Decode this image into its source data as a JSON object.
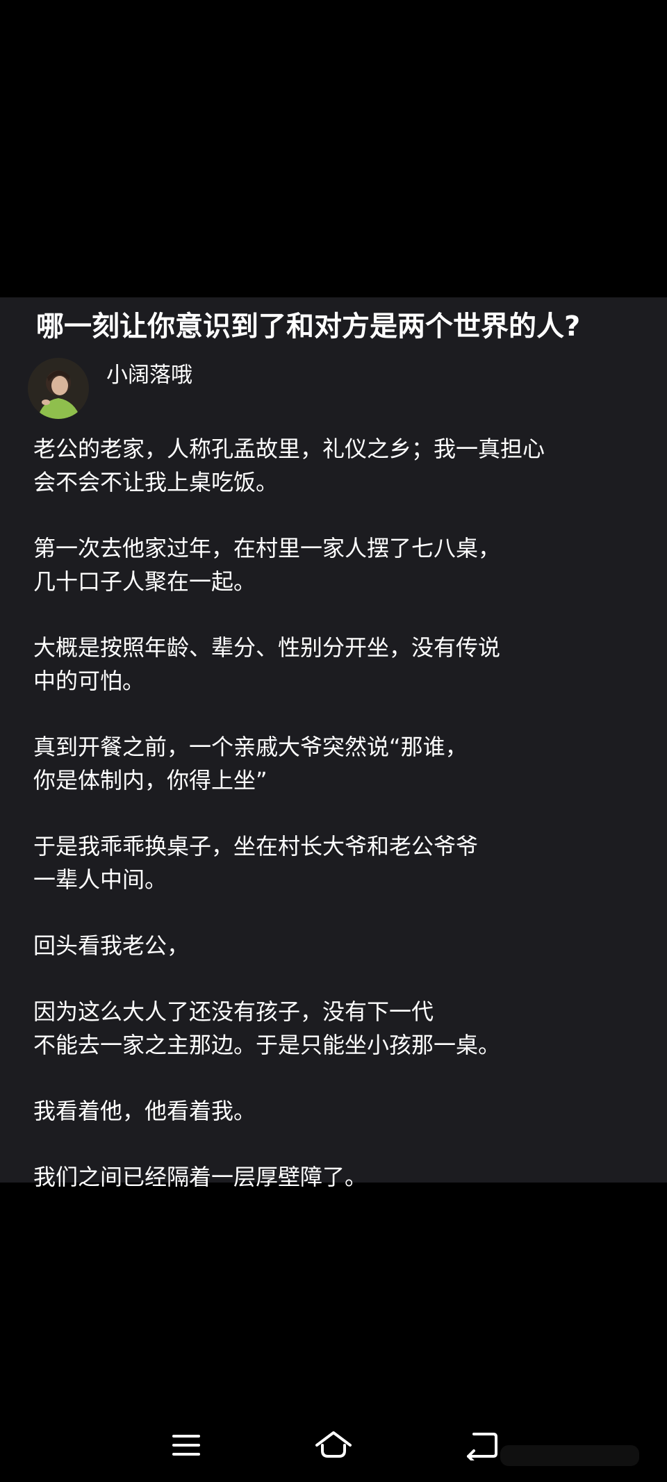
{
  "post": {
    "title": "哪一刻让你意识到了和对方是两个世界的人?",
    "author": {
      "name": "小阔落哦",
      "avatar_icon": "avatar-photo"
    },
    "paragraphs": [
      {
        "lines": [
          "老公的老家，人称孔孟故里，礼仪之乡；我一真担心",
          "会不会不让我上桌吃饭。"
        ]
      },
      {
        "lines": [
          "第一次去他家过年，在村里一家人摆了七八桌，",
          "几十口子人聚在一起。"
        ]
      },
      {
        "lines": [
          "大概是按照年龄、辈分、性别分开坐，没有传说",
          "中的可怕。"
        ]
      },
      {
        "lines": [
          "真到开餐之前，一个亲戚大爷突然说“那谁，",
          "你是体制内，你得上坐”"
        ]
      },
      {
        "lines": [
          "于是我乖乖换桌子，坐在村长大爷和老公爷爷",
          "一辈人中间。"
        ]
      },
      {
        "lines": [
          "回头看我老公，"
        ]
      },
      {
        "lines": [
          "因为这么大人了还没有孩子，没有下一代",
          "不能去一家之主那边。于是只能坐小孩那一桌。"
        ]
      },
      {
        "lines": [
          "我看着他，他看着我。"
        ]
      },
      {
        "lines": [
          "我们之间已经隔着一层厚壁障了。"
        ]
      }
    ]
  },
  "navigation": {
    "buttons": [
      {
        "name": "menu-icon"
      },
      {
        "name": "home-icon"
      },
      {
        "name": "back-icon"
      }
    ]
  },
  "colors": {
    "screen_background": "#000000",
    "panel_background": "#1c1c20",
    "text": "#ffffff",
    "nav_icon": "#ffffff"
  }
}
